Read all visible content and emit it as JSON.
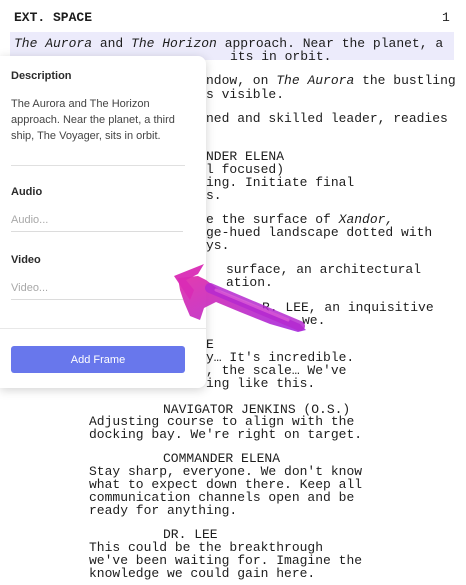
{
  "script": {
    "scene_heading": "EXT. SPACE",
    "page_number": "1",
    "lines": [
      "approach. Near the planet, a",
      "its in orbit.",
      "ndow, on",
      "the bustling",
      "s visible.",
      "ned and skilled leader, readies",
      "NDER ELENA",
      "l focused)",
      "ing. Initiate final",
      "s.",
      "e the surface of",
      "ge-hued landscape dotted with",
      "ys.",
      "surface, an architectural",
      "ation.",
      "R. LEE, an inquisitive",
      "we.",
      "E",
      "y… It's incredible.",
      ", the scale… We've",
      "ing like this."
    ],
    "highlight_names": [
      "The Aurora",
      "and",
      "The Horizon"
    ],
    "italic_aurora": "The Aurora",
    "italic_xandor": "Xandor,",
    "dialogue": [
      {
        "speaker": "NAVIGATOR JENKINS (O.S.)",
        "lines": [
          "Adjusting course to align with the",
          "docking bay. We're right on target."
        ]
      },
      {
        "speaker": "COMMANDER ELENA",
        "lines": [
          "Stay sharp, everyone. We don't know",
          "what to expect down there. Keep all",
          "communication channels open and be",
          "ready for anything."
        ]
      },
      {
        "speaker": "DR. LEE",
        "lines": [
          "This could be the breakthrough",
          "we've been waiting for. Imagine the",
          "knowledge we could gain here."
        ]
      }
    ]
  },
  "panel": {
    "description_label": "Description",
    "description_text": "The Aurora and The Horizon approach. Near the planet, a third ship, The Voyager, sits in orbit.",
    "audio_label": "Audio",
    "audio_placeholder": "Audio...",
    "video_label": "Video",
    "video_placeholder": "Video...",
    "add_frame_label": "Add Frame",
    "accent_color": "#6877ec"
  },
  "annotation": {
    "arrow_icon": "arrow-icon",
    "arrow_color": "#c72bc4"
  }
}
